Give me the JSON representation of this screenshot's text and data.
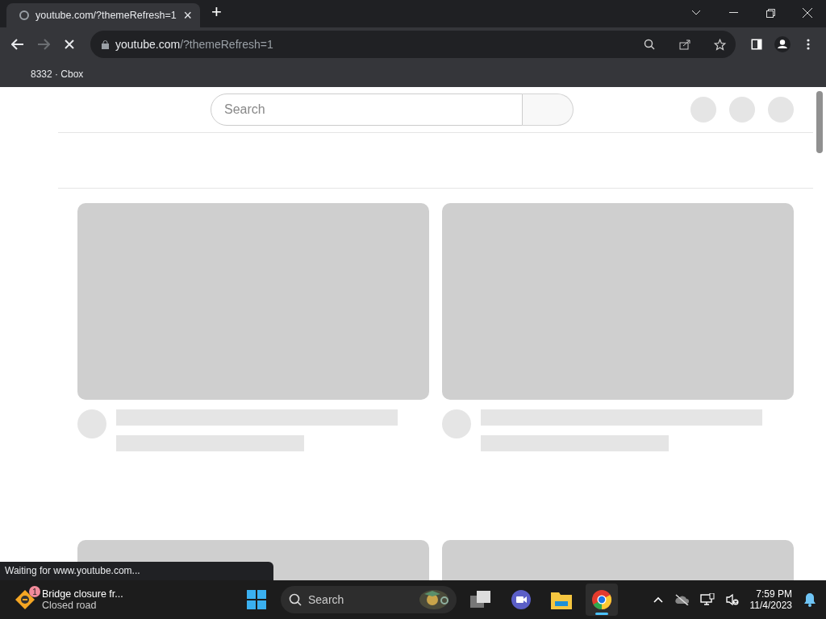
{
  "browser": {
    "tabs": [
      {
        "title": "youtube.com/?themeRefresh=1",
        "selected": true,
        "close": "×"
      }
    ],
    "new_tab": "+",
    "loading": true,
    "address": {
      "host": "youtube.com",
      "path": "/?themeRefresh=1"
    },
    "bookmarks": [
      "8332 · Cbox"
    ],
    "status": "Waiting for www.youtube.com..."
  },
  "page": {
    "search": {
      "placeholder": "Search"
    },
    "header_buttons": [
      {
        "kind": "placeholder"
      },
      {
        "kind": "placeholder"
      },
      {
        "kind": "placeholder"
      }
    ],
    "cards": [
      {
        "kind": "skeleton"
      },
      {
        "kind": "skeleton"
      },
      {
        "kind": "thumbnail-only"
      },
      {
        "kind": "thumbnail-only"
      }
    ]
  },
  "taskbar": {
    "notification": {
      "badge": "1",
      "title": "Bridge closure fr...",
      "subtitle": "Closed road"
    },
    "search": {
      "placeholder": "Search"
    },
    "apps": [
      {
        "kind": "task-view",
        "selected": false
      },
      {
        "kind": "chat",
        "selected": false
      },
      {
        "kind": "files",
        "selected": false
      },
      {
        "kind": "browser",
        "selected": true
      }
    ],
    "time": "7:59 PM",
    "date": "11/4/2023"
  }
}
